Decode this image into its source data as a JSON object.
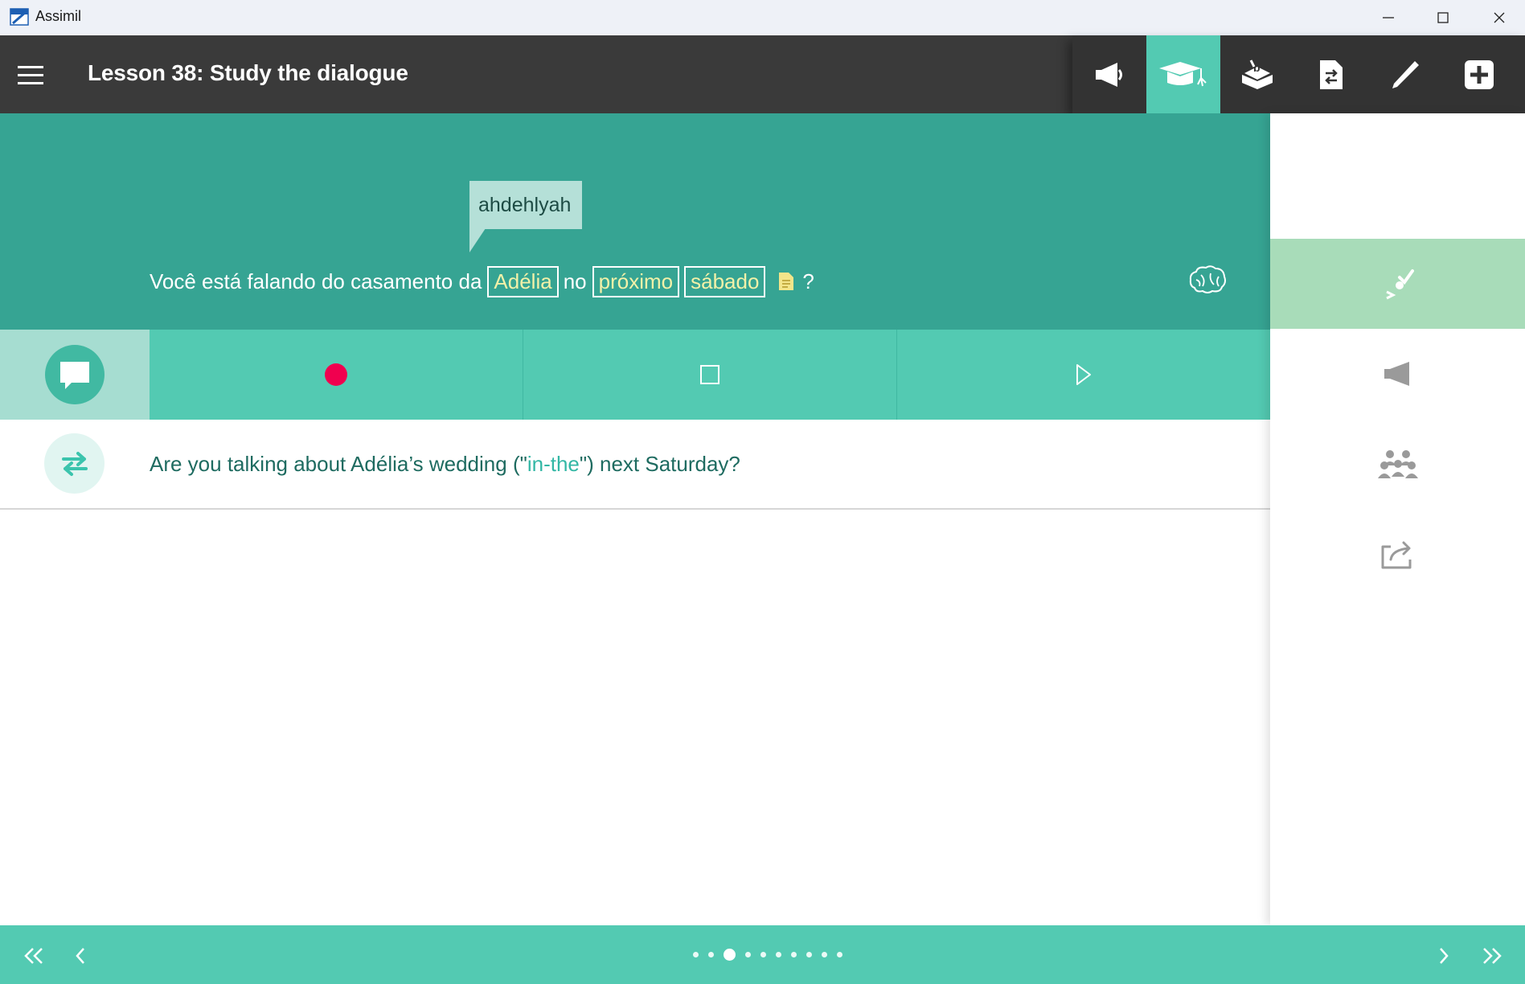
{
  "window": {
    "title": "Assimil"
  },
  "header": {
    "title": "Lesson 38: Study the dialogue"
  },
  "toolbar": {
    "tools": [
      "megaphone-icon",
      "graduation-cap-icon",
      "book-icon",
      "document-translate-icon",
      "pen-icon",
      "plus-icon"
    ],
    "active": "graduation-cap-icon"
  },
  "sentence": {
    "tooltip": "ahdehlyah",
    "part1": "Você está falando do casamento da",
    "word1": "Adélia",
    "part2": "no",
    "word2": "próximo",
    "word3": "sábado",
    "end": "?"
  },
  "translation": {
    "before": "Are you talking about Adélia’s wedding (\"",
    "literal": "in-the",
    "after": "\") next Saturday?"
  },
  "pagination": {
    "total": 10,
    "current": 3
  },
  "colors": {
    "teal_dark": "#36a493",
    "teal": "#53cab2",
    "record": "#f0004f",
    "header": "#3a3a3a"
  }
}
